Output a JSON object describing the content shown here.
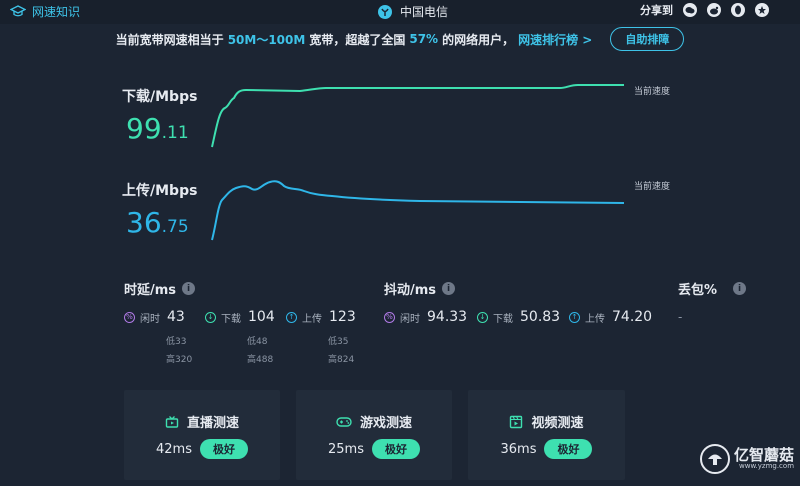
{
  "topbar": {
    "knowledge_label": "网速知识",
    "isp": "中国电信",
    "share_label": "分享到"
  },
  "banner": {
    "prefix": "当前宽带网速相当于",
    "range": "50M～100M",
    "suffix1": "宽带，超越了全国",
    "percent": "57%",
    "suffix2": "的网络用户，",
    "rank_link": "网速排行榜 >",
    "auto_button": "自助排障"
  },
  "download": {
    "label": "下载/Mbps",
    "value_int": "99",
    "value_dec": ".11",
    "current_label": "当前速度"
  },
  "upload": {
    "label": "上传/Mbps",
    "value_int": "36",
    "value_dec": ".75",
    "current_label": "当前速度"
  },
  "latency": {
    "title": "时延/ms",
    "idle_label": "闲时",
    "idle_value": "43",
    "down_label": "下载",
    "down_value": "104",
    "up_label": "上传",
    "up_value": "123",
    "idle_low": "低33",
    "idle_high": "高320",
    "down_low": "低48",
    "down_high": "高488",
    "up_low": "低35",
    "up_high": "高824"
  },
  "jitter": {
    "title": "抖动/ms",
    "idle_label": "闲时",
    "idle_value": "94.33",
    "down_label": "下载",
    "down_value": "50.83",
    "up_label": "上传",
    "up_value": "74.20"
  },
  "loss": {
    "title": "丢包%",
    "value": "-"
  },
  "cards": [
    {
      "title": "直播测速",
      "ms": "42ms",
      "badge": "极好"
    },
    {
      "title": "游戏测速",
      "ms": "25ms",
      "badge": "极好"
    },
    {
      "title": "视频测速",
      "ms": "36ms",
      "badge": "极好"
    }
  ],
  "watermark": {
    "name": "亿智蘑菇",
    "url": "www.yzmg.com"
  },
  "colors": {
    "background": "#1c2533",
    "accent": "#3ec3e8",
    "download": "#3ee0b0",
    "upload": "#2fb6e8"
  }
}
